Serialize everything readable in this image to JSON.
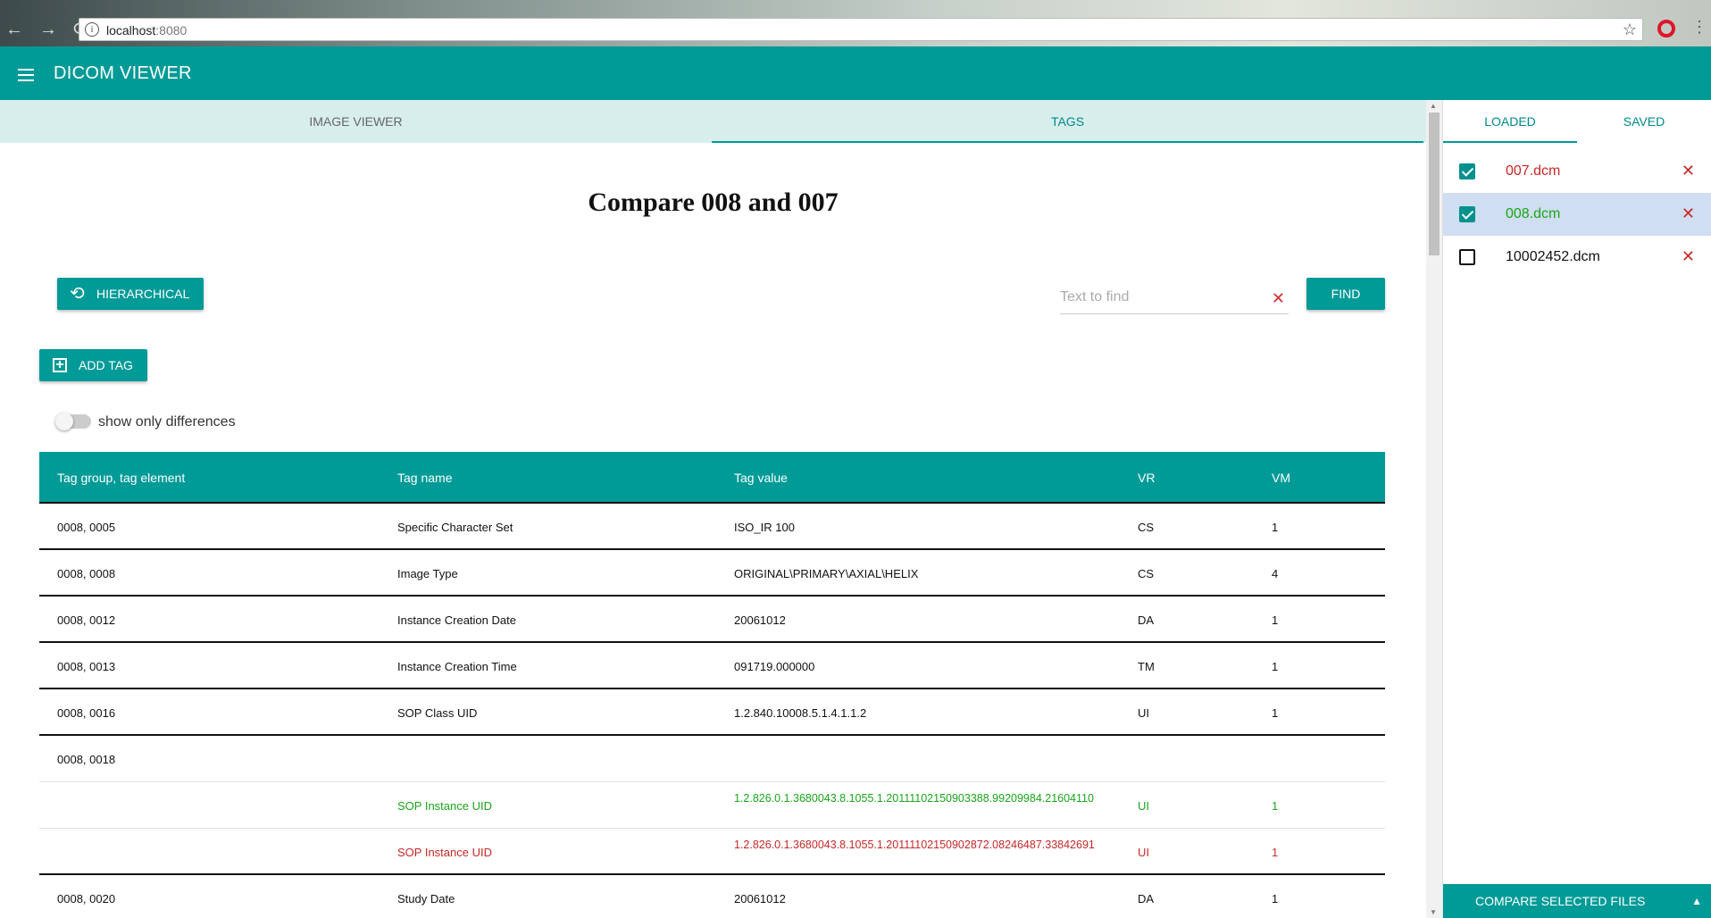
{
  "browser": {
    "url_host": "localhost",
    "url_port": ":8080"
  },
  "app": {
    "title": "DICOM VIEWER"
  },
  "main_tabs": [
    {
      "label": "IMAGE VIEWER",
      "active": false
    },
    {
      "label": "TAGS",
      "active": true
    }
  ],
  "page": {
    "title": "Compare 008 and 007",
    "hierarchical_label": "HIERARCHICAL",
    "add_tag_label": "ADD TAG",
    "find_label": "FIND",
    "search_placeholder": "Text to find",
    "search_value": "",
    "toggle_label": "show only differences",
    "toggle_on": false
  },
  "table": {
    "headers": [
      "Tag group, tag element",
      "Tag name",
      "Tag value",
      "VR",
      "VM"
    ],
    "rows": [
      {
        "tag": "0008, 0005",
        "name": "Specific Character Set",
        "value": "ISO_IR 100",
        "vr": "CS",
        "vm": "1"
      },
      {
        "tag": "0008, 0008",
        "name": "Image Type",
        "value": "ORIGINAL\\PRIMARY\\AXIAL\\HELIX",
        "vr": "CS",
        "vm": "4"
      },
      {
        "tag": "0008, 0012",
        "name": "Instance Creation Date",
        "value": "20061012",
        "vr": "DA",
        "vm": "1"
      },
      {
        "tag": "0008, 0013",
        "name": "Instance Creation Time",
        "value": "091719.000000",
        "vr": "TM",
        "vm": "1"
      },
      {
        "tag": "0008, 0016",
        "name": "SOP Class UID",
        "value": "1.2.840.10008.5.1.4.1.1.2",
        "vr": "UI",
        "vm": "1"
      },
      {
        "tag": "0008, 0018",
        "name": "",
        "value": "",
        "vr": "",
        "vm": ""
      },
      {
        "tag": "",
        "name": "SOP Instance UID",
        "value": "1.2.826.0.1.3680043.8.1055.1.20111102150903388.99209984.21604110",
        "vr": "UI",
        "vm": "1",
        "diff": "green"
      },
      {
        "tag": "",
        "name": "SOP Instance UID",
        "value": "1.2.826.0.1.3680043.8.1055.1.20111102150902872.08246487.33842691",
        "vr": "UI",
        "vm": "1",
        "diff": "red"
      },
      {
        "tag": "0008, 0020",
        "name": "Study Date",
        "value": "20061012",
        "vr": "DA",
        "vm": "1"
      }
    ]
  },
  "side_panel": {
    "tabs": [
      {
        "label": "LOADED",
        "active": true
      },
      {
        "label": "SAVED",
        "active": false
      }
    ],
    "files": [
      {
        "name": "007.dcm",
        "checked": true,
        "color": "#c62828",
        "selected": false
      },
      {
        "name": "008.dcm",
        "checked": true,
        "color": "#1aa51a",
        "selected": true
      },
      {
        "name": "10002452.dcm",
        "checked": false,
        "color": "#111111",
        "selected": false
      }
    ],
    "compare_label": "COMPARE SELECTED FILES"
  },
  "colors": {
    "primary": "#009a97",
    "diff_new": "#1aa51a",
    "diff_old": "#c62828"
  }
}
